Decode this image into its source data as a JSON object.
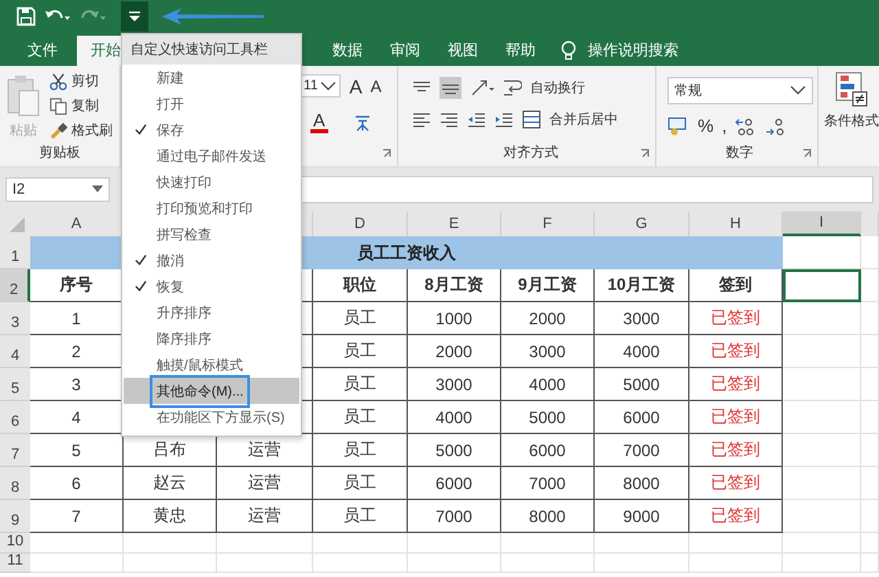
{
  "quick_access": [
    {
      "kind": "save",
      "disabled": false
    },
    {
      "kind": "undo",
      "disabled": false
    },
    {
      "kind": "redo",
      "disabled": true
    },
    {
      "kind": "customize",
      "expanded": true
    }
  ],
  "tabs": [
    {
      "label": "文件",
      "selected": false
    },
    {
      "label": "开始",
      "selected": true
    },
    {
      "label": "数据",
      "selected": false
    },
    {
      "label": "审阅",
      "selected": false
    },
    {
      "label": "视图",
      "selected": false
    },
    {
      "label": "帮助",
      "selected": false
    }
  ],
  "tell_me": "操作说明搜索",
  "ribbon": {
    "clipboard": {
      "paste": "粘贴",
      "cut": "剪切",
      "copy": "复制",
      "format_painter": "格式刷",
      "label": "剪贴板"
    },
    "font": {
      "size": "11",
      "grow": "A",
      "shrink": "A",
      "font_color": "A"
    },
    "alignment": {
      "wrap": "自动换行",
      "merge": "合并后居中",
      "label": "对齐方式"
    },
    "number": {
      "format": "常规",
      "percent": "%",
      "comma": ",",
      "label": "数字"
    },
    "styles": {
      "conditional": "条件格式"
    }
  },
  "name_box": "I2",
  "columns": [
    {
      "label": "A",
      "selected": false
    },
    {
      "label": "D",
      "selected": false
    },
    {
      "label": "E",
      "selected": false
    },
    {
      "label": "F",
      "selected": false
    },
    {
      "label": "G",
      "selected": false
    },
    {
      "label": "H",
      "selected": false
    },
    {
      "label": "I",
      "selected": true
    }
  ],
  "title_row": {
    "num": "1",
    "text": "员工工资收入"
  },
  "rows": [
    {
      "num": "2",
      "selected": true,
      "kind": "header",
      "cells": [
        "序号",
        null,
        null,
        "职位",
        "8月工资",
        "9月工资",
        "10月工资",
        "签到"
      ]
    },
    {
      "num": "3",
      "selected": false,
      "kind": "data",
      "cells": [
        "1",
        null,
        null,
        "员工",
        "1000",
        "2000",
        "3000",
        "已签到"
      ]
    },
    {
      "num": "4",
      "selected": false,
      "kind": "data",
      "cells": [
        "2",
        null,
        null,
        "员工",
        "2000",
        "3000",
        "4000",
        "已签到"
      ]
    },
    {
      "num": "5",
      "selected": false,
      "kind": "data",
      "cells": [
        "3",
        null,
        null,
        "员工",
        "3000",
        "4000",
        "5000",
        "已签到"
      ]
    },
    {
      "num": "6",
      "selected": false,
      "kind": "data",
      "cells": [
        "4",
        null,
        null,
        "员工",
        "4000",
        "5000",
        "6000",
        "已签到"
      ]
    },
    {
      "num": "7",
      "selected": false,
      "kind": "data",
      "cells": [
        "5",
        "吕布",
        "运营",
        "员工",
        "5000",
        "6000",
        "7000",
        "已签到"
      ]
    },
    {
      "num": "8",
      "selected": false,
      "kind": "data",
      "cells": [
        "6",
        "赵云",
        "运营",
        "员工",
        "6000",
        "7000",
        "8000",
        "已签到"
      ]
    },
    {
      "num": "9",
      "selected": false,
      "kind": "data",
      "cells": [
        "7",
        "黄忠",
        "运营",
        "员工",
        "7000",
        "8000",
        "9000",
        "已签到"
      ]
    },
    {
      "num": "10",
      "selected": false,
      "kind": "empty"
    },
    {
      "num": "11",
      "selected": false,
      "kind": "empty"
    }
  ],
  "menu": {
    "title": "自定义快速访问工具栏",
    "items": [
      {
        "label": "新建",
        "checked": false,
        "selected": false
      },
      {
        "label": "打开",
        "checked": false,
        "selected": false
      },
      {
        "label": "保存",
        "checked": true,
        "selected": false
      },
      {
        "label": "通过电子邮件发送",
        "checked": false,
        "selected": false
      },
      {
        "label": "快速打印",
        "checked": false,
        "selected": false
      },
      {
        "label": "打印预览和打印",
        "checked": false,
        "selected": false
      },
      {
        "label": "拼写检查",
        "checked": false,
        "selected": false
      },
      {
        "label": "撤消",
        "checked": true,
        "selected": false
      },
      {
        "label": "恢复",
        "checked": true,
        "selected": false
      },
      {
        "label": "升序排序",
        "checked": false,
        "selected": false
      },
      {
        "label": "降序排序",
        "checked": false,
        "selected": false
      },
      {
        "label": "触摸/鼠标模式",
        "checked": false,
        "selected": false
      },
      {
        "label": "其他命令(M)...",
        "checked": false,
        "selected": true
      },
      {
        "label": "在功能区下方显示(S)",
        "checked": false,
        "selected": false
      }
    ]
  }
}
